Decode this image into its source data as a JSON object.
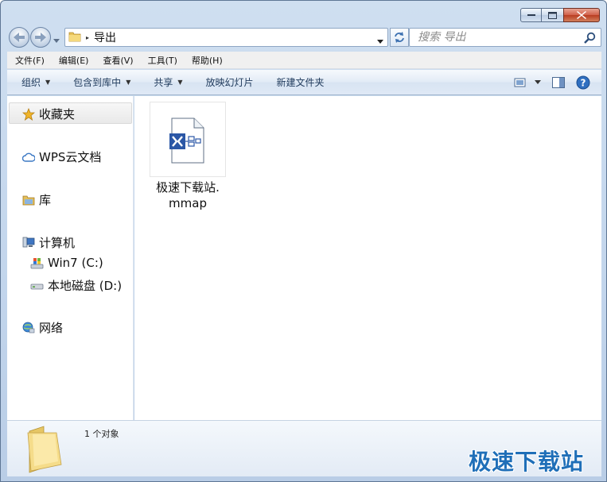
{
  "window": {
    "caption_buttons": [
      "minimize",
      "maximize",
      "close"
    ]
  },
  "address_bar": {
    "path_segment": "导出",
    "separator": "▸"
  },
  "search": {
    "placeholder": "搜索 导出"
  },
  "menu": {
    "items": [
      "文件(F)",
      "编辑(E)",
      "查看(V)",
      "工具(T)",
      "帮助(H)"
    ]
  },
  "toolbar": {
    "organize": "组织",
    "include_in_library": "包含到库中",
    "share": "共享",
    "slideshow": "放映幻灯片",
    "new_folder": "新建文件夹"
  },
  "nav_pane": {
    "favorites": "收藏夹",
    "wps_cloud": "WPS云文档",
    "libraries": "库",
    "computer": "计算机",
    "drive_c": "Win7 (C:)",
    "drive_d": "本地磁盘 (D:)",
    "network": "网络"
  },
  "files": [
    {
      "name_line1": "极速下载站.",
      "name_line2": "mmap",
      "icon": "mindmanager-file-icon"
    }
  ],
  "details": {
    "count": "1 个对象"
  },
  "watermark": {
    "text": "极速下载站"
  },
  "colors": {
    "chrome": "#c2d5ec",
    "watermark": "#1f6fb8",
    "link_text": "#1e395b"
  }
}
